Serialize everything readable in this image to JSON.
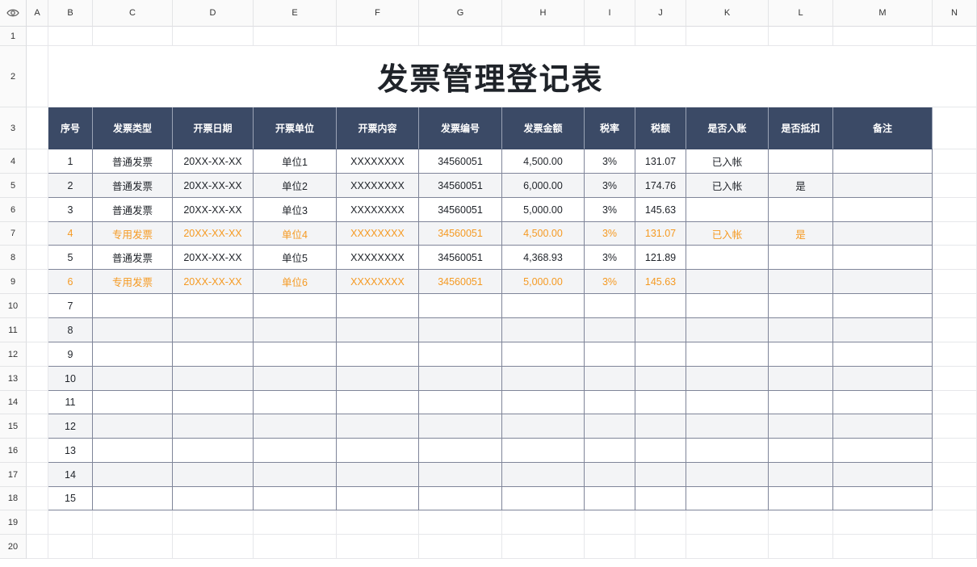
{
  "columns": [
    "A",
    "B",
    "C",
    "D",
    "E",
    "F",
    "G",
    "H",
    "I",
    "J",
    "K",
    "L",
    "M",
    "N"
  ],
  "rows": [
    "1",
    "2",
    "3",
    "4",
    "5",
    "6",
    "7",
    "8",
    "9",
    "10",
    "11",
    "12",
    "13",
    "14",
    "15",
    "16",
    "17",
    "18",
    "19",
    "20"
  ],
  "title": "发票管理登记表",
  "headers": [
    "序号",
    "发票类型",
    "开票日期",
    "开票单位",
    "开票内容",
    "发票编号",
    "发票金额",
    "税率",
    "税额",
    "是否入账",
    "是否抵扣",
    "备注"
  ],
  "records": [
    {
      "seq": "1",
      "type": "普通发票",
      "date": "20XX-XX-XX",
      "unit": "单位1",
      "content": "XXXXXXXX",
      "number": "34560051",
      "amount": "4,500.00",
      "rate": "3%",
      "tax": "131.07",
      "booked": "已入帐",
      "deduct": "",
      "note": "",
      "orange": false
    },
    {
      "seq": "2",
      "type": "普通发票",
      "date": "20XX-XX-XX",
      "unit": "单位2",
      "content": "XXXXXXXX",
      "number": "34560051",
      "amount": "6,000.00",
      "rate": "3%",
      "tax": "174.76",
      "booked": "已入帐",
      "deduct": "是",
      "note": "",
      "orange": false
    },
    {
      "seq": "3",
      "type": "普通发票",
      "date": "20XX-XX-XX",
      "unit": "单位3",
      "content": "XXXXXXXX",
      "number": "34560051",
      "amount": "5,000.00",
      "rate": "3%",
      "tax": "145.63",
      "booked": "",
      "deduct": "",
      "note": "",
      "orange": false
    },
    {
      "seq": "4",
      "type": "专用发票",
      "date": "20XX-XX-XX",
      "unit": "单位4",
      "content": "XXXXXXXX",
      "number": "34560051",
      "amount": "4,500.00",
      "rate": "3%",
      "tax": "131.07",
      "booked": "已入帐",
      "deduct": "是",
      "note": "",
      "orange": true
    },
    {
      "seq": "5",
      "type": "普通发票",
      "date": "20XX-XX-XX",
      "unit": "单位5",
      "content": "XXXXXXXX",
      "number": "34560051",
      "amount": "4,368.93",
      "rate": "3%",
      "tax": "121.89",
      "booked": "",
      "deduct": "",
      "note": "",
      "orange": false
    },
    {
      "seq": "6",
      "type": "专用发票",
      "date": "20XX-XX-XX",
      "unit": "单位6",
      "content": "XXXXXXXX",
      "number": "34560051",
      "amount": "5,000.00",
      "rate": "3%",
      "tax": "145.63",
      "booked": "",
      "deduct": "",
      "note": "",
      "orange": true
    },
    {
      "seq": "7",
      "type": "",
      "date": "",
      "unit": "",
      "content": "",
      "number": "",
      "amount": "",
      "rate": "",
      "tax": "",
      "booked": "",
      "deduct": "",
      "note": "",
      "orange": false
    },
    {
      "seq": "8",
      "type": "",
      "date": "",
      "unit": "",
      "content": "",
      "number": "",
      "amount": "",
      "rate": "",
      "tax": "",
      "booked": "",
      "deduct": "",
      "note": "",
      "orange": false
    },
    {
      "seq": "9",
      "type": "",
      "date": "",
      "unit": "",
      "content": "",
      "number": "",
      "amount": "",
      "rate": "",
      "tax": "",
      "booked": "",
      "deduct": "",
      "note": "",
      "orange": false
    },
    {
      "seq": "10",
      "type": "",
      "date": "",
      "unit": "",
      "content": "",
      "number": "",
      "amount": "",
      "rate": "",
      "tax": "",
      "booked": "",
      "deduct": "",
      "note": "",
      "orange": false
    },
    {
      "seq": "11",
      "type": "",
      "date": "",
      "unit": "",
      "content": "",
      "number": "",
      "amount": "",
      "rate": "",
      "tax": "",
      "booked": "",
      "deduct": "",
      "note": "",
      "orange": false
    },
    {
      "seq": "12",
      "type": "",
      "date": "",
      "unit": "",
      "content": "",
      "number": "",
      "amount": "",
      "rate": "",
      "tax": "",
      "booked": "",
      "deduct": "",
      "note": "",
      "orange": false
    },
    {
      "seq": "13",
      "type": "",
      "date": "",
      "unit": "",
      "content": "",
      "number": "",
      "amount": "",
      "rate": "",
      "tax": "",
      "booked": "",
      "deduct": "",
      "note": "",
      "orange": false
    },
    {
      "seq": "14",
      "type": "",
      "date": "",
      "unit": "",
      "content": "",
      "number": "",
      "amount": "",
      "rate": "",
      "tax": "",
      "booked": "",
      "deduct": "",
      "note": "",
      "orange": false
    },
    {
      "seq": "15",
      "type": "",
      "date": "",
      "unit": "",
      "content": "",
      "number": "",
      "amount": "",
      "rate": "",
      "tax": "",
      "booked": "",
      "deduct": "",
      "note": "",
      "orange": false
    }
  ],
  "colors": {
    "header_bg": "#3b4a66",
    "accent_orange": "#f59a23",
    "alt_row": "#f3f4f6"
  },
  "icons": {
    "corner": "eye-icon",
    "freeze_col": "freeze-column-handle-icon",
    "freeze_row": "freeze-row-handle-icon"
  }
}
